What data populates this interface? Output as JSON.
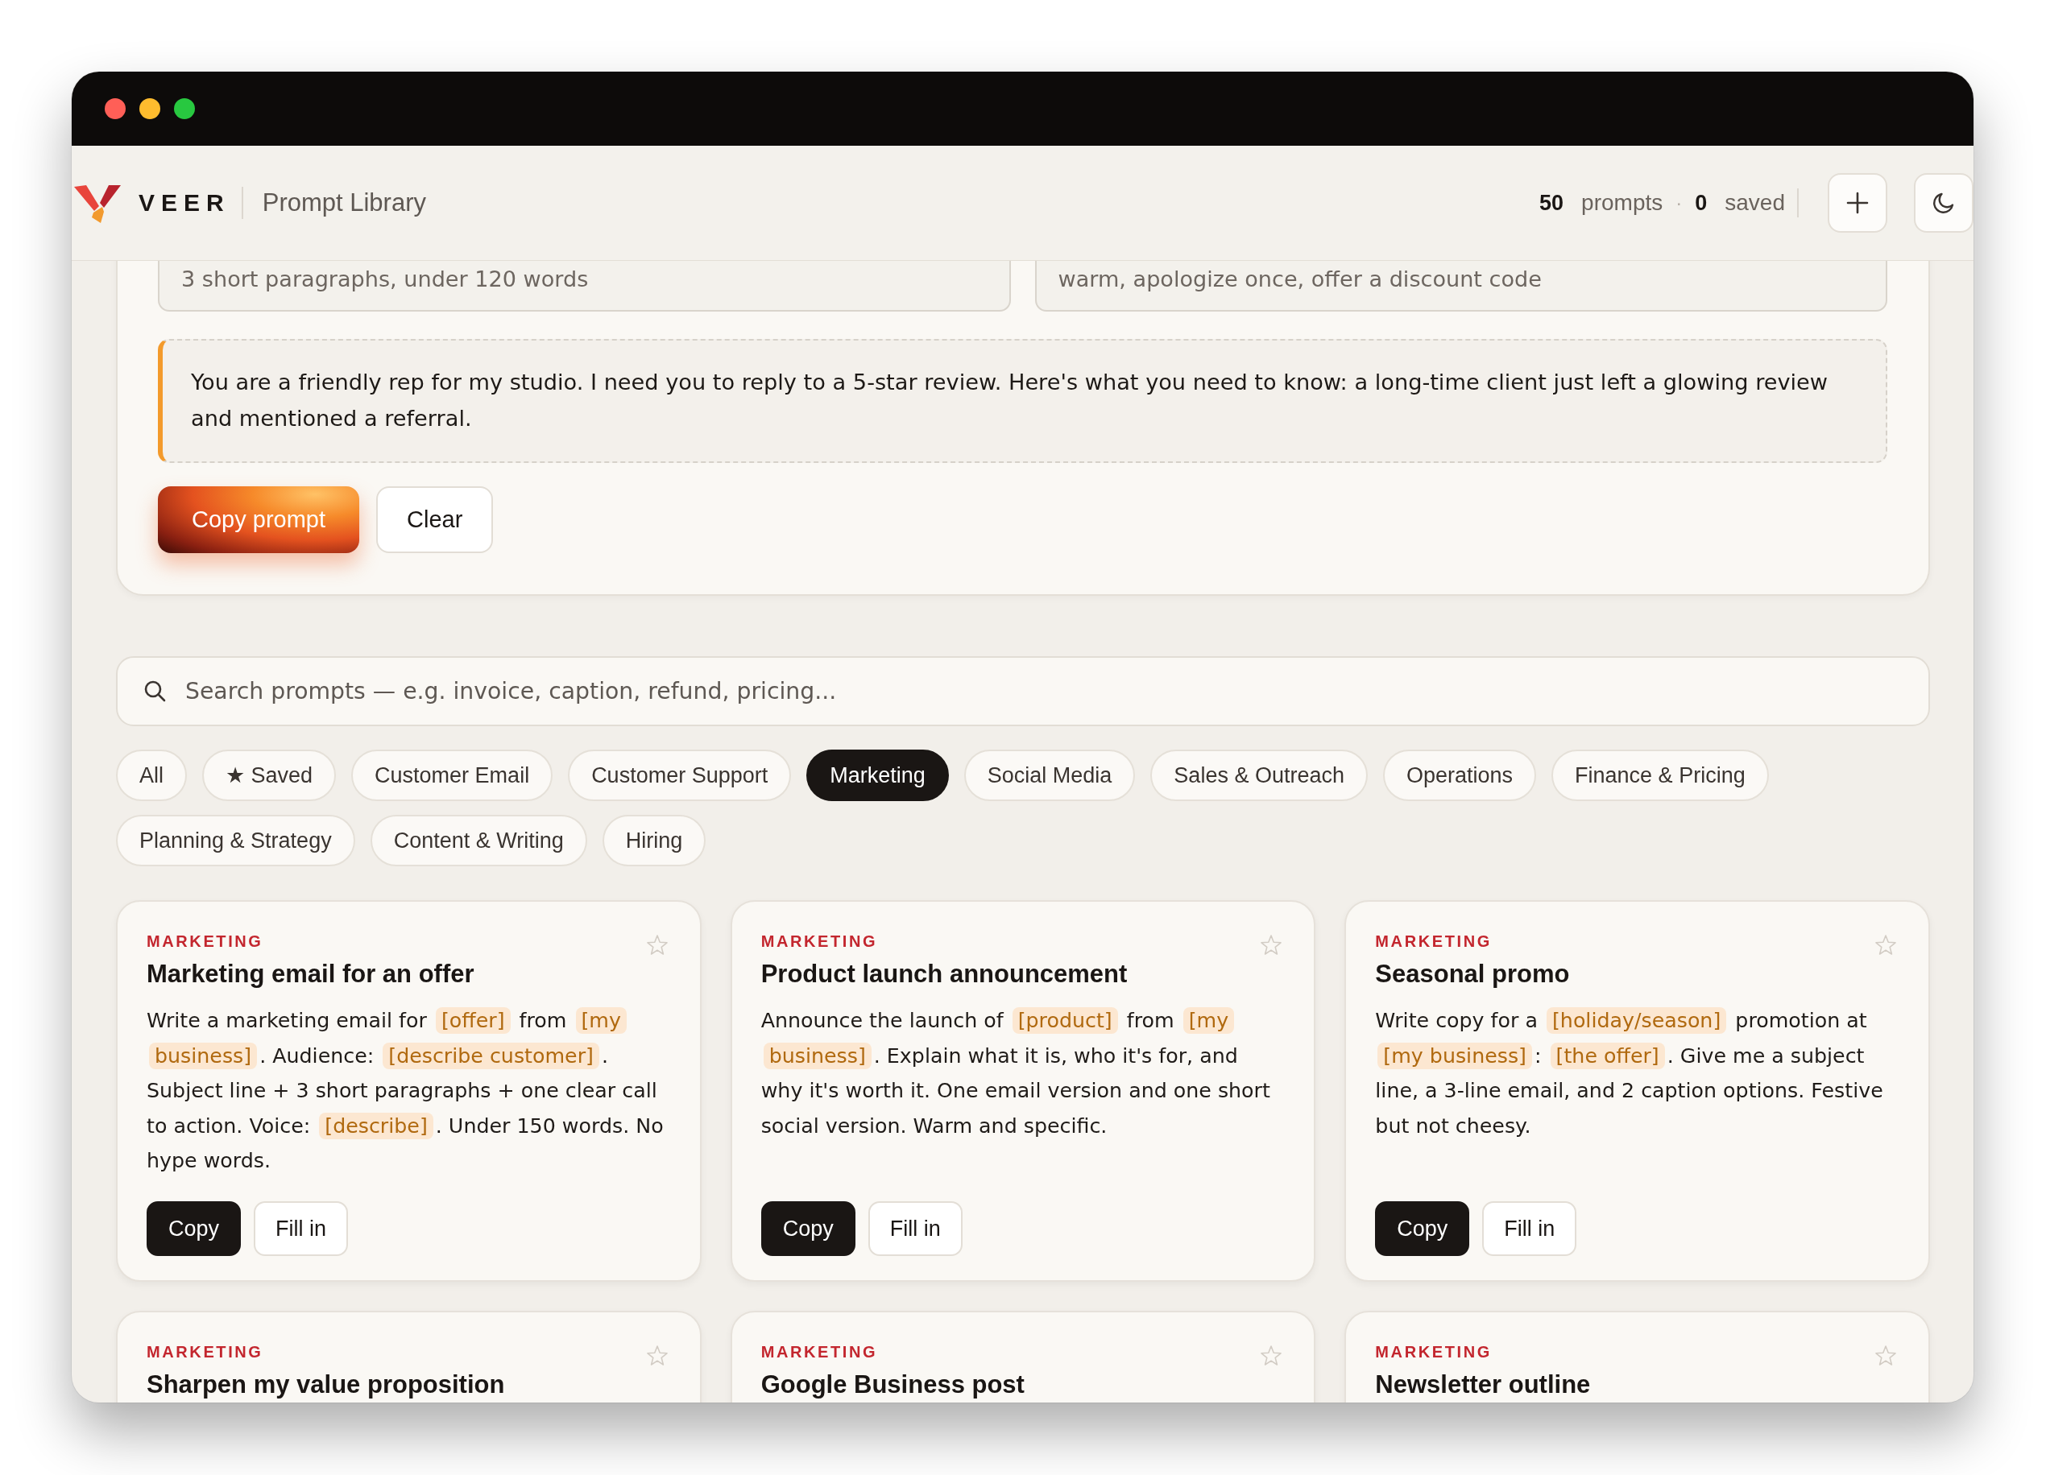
{
  "header": {
    "brand": "VEER",
    "title": "Prompt Library",
    "stats": [
      {
        "count": "50",
        "unit": "prompts"
      },
      {
        "count": "0",
        "unit": "saved"
      }
    ],
    "separator": "·"
  },
  "builder": {
    "fields": [
      {
        "placeholder": "3 short paragraphs, under 120 words"
      },
      {
        "placeholder": "warm, apologize once, offer a discount code"
      }
    ],
    "preview": "You are a friendly rep for my studio. I need you to reply to a 5-star review. Here's what you need to know: a long-time client just left a glowing review and mentioned a referral.",
    "buttons": [
      {
        "label": "Copy prompt",
        "kind": "primary"
      },
      {
        "label": "Clear",
        "kind": "secondary"
      }
    ]
  },
  "search": {
    "placeholder": "Search prompts — e.g. invoice, caption, refund, pricing..."
  },
  "filters": [
    {
      "label": "All",
      "selected": false
    },
    {
      "label": "★ Saved",
      "selected": false
    },
    {
      "label": "Customer Email",
      "selected": false
    },
    {
      "label": "Customer Support",
      "selected": false
    },
    {
      "label": "Marketing",
      "selected": true
    },
    {
      "label": "Social Media",
      "selected": false
    },
    {
      "label": "Sales & Outreach",
      "selected": false
    },
    {
      "label": "Operations",
      "selected": false
    },
    {
      "label": "Finance & Pricing",
      "selected": false
    },
    {
      "label": "Planning & Strategy",
      "selected": false
    },
    {
      "label": "Content & Writing",
      "selected": false
    },
    {
      "label": "Hiring",
      "selected": false
    }
  ],
  "cards": [
    {
      "category": "MARKETING",
      "title": "Marketing email for an offer",
      "saved": false,
      "body": [
        {
          "kind": "text",
          "text": "Write a marketing email for "
        },
        {
          "kind": "variable",
          "text": "[offer]"
        },
        {
          "kind": "text",
          "text": " from "
        },
        {
          "kind": "variable",
          "text": "[my business]"
        },
        {
          "kind": "text",
          "text": ". Audience: "
        },
        {
          "kind": "variable",
          "text": "[describe customer]"
        },
        {
          "kind": "text",
          "text": ". Subject line + 3 short paragraphs + one clear call to action. Voice: "
        },
        {
          "kind": "variable",
          "text": "[describe]"
        },
        {
          "kind": "text",
          "text": ". Under 150 words. No hype words."
        }
      ],
      "buttons": [
        {
          "label": "Copy",
          "kind": "primary"
        },
        {
          "label": "Fill in",
          "kind": "secondary"
        }
      ]
    },
    {
      "category": "MARKETING",
      "title": "Product launch announcement",
      "saved": false,
      "body": [
        {
          "kind": "text",
          "text": "Announce the launch of "
        },
        {
          "kind": "variable",
          "text": "[product]"
        },
        {
          "kind": "text",
          "text": " from "
        },
        {
          "kind": "variable",
          "text": "[my business]"
        },
        {
          "kind": "text",
          "text": ". Explain what it is, who it's for, and why it's worth it. One email version and one short social version. Warm and specific."
        }
      ],
      "buttons": [
        {
          "label": "Copy",
          "kind": "primary"
        },
        {
          "label": "Fill in",
          "kind": "secondary"
        }
      ]
    },
    {
      "category": "MARKETING",
      "title": "Seasonal promo",
      "saved": false,
      "body": [
        {
          "kind": "text",
          "text": "Write copy for a "
        },
        {
          "kind": "variable",
          "text": "[holiday/season]"
        },
        {
          "kind": "text",
          "text": " promotion at "
        },
        {
          "kind": "variable",
          "text": "[my business]"
        },
        {
          "kind": "text",
          "text": ": "
        },
        {
          "kind": "variable",
          "text": "[the offer]"
        },
        {
          "kind": "text",
          "text": ". Give me a subject line, a 3-line email, and 2 caption options. Festive but not cheesy."
        }
      ],
      "buttons": [
        {
          "label": "Copy",
          "kind": "primary"
        },
        {
          "label": "Fill in",
          "kind": "secondary"
        }
      ]
    },
    {
      "category": "MARKETING",
      "title": "Sharpen my value proposition",
      "saved": false
    },
    {
      "category": "MARKETING",
      "title": "Google Business post",
      "saved": false
    },
    {
      "category": "MARKETING",
      "title": "Newsletter outline",
      "saved": false
    }
  ]
}
